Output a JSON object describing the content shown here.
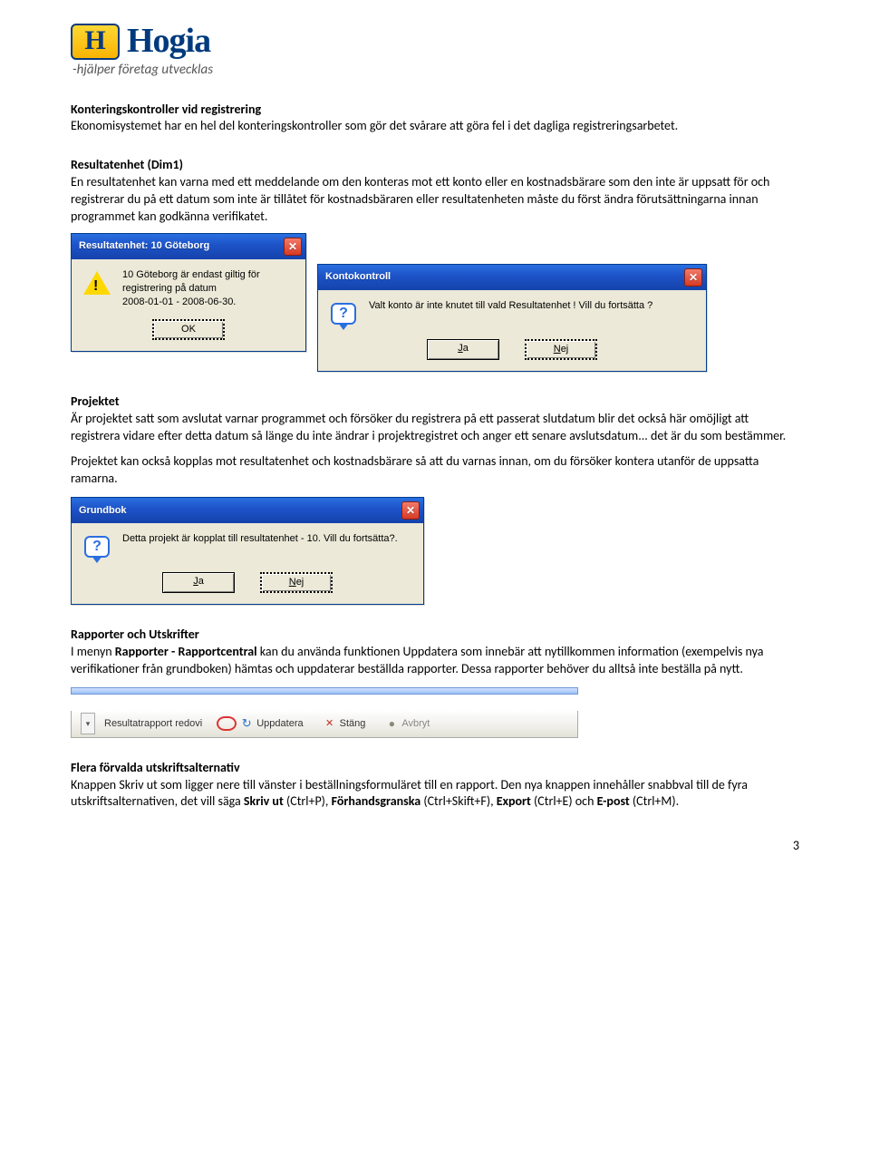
{
  "logo": {
    "mark": "H",
    "brand": "Hogia",
    "tagline": "-hjälper företag utvecklas"
  },
  "s1": {
    "h": "Konteringskontroller vid registrering",
    "p": "Ekonomisystemet har en hel del konteringskontroller som gör det svårare att göra fel i det dagliga registreringsarbetet."
  },
  "s2": {
    "h": "Resultatenhet (Dim1)",
    "p": "En resultatenhet kan varna med ett meddelande om den konteras mot ett konto eller en kostnadsbärare som den inte är uppsatt för och registrerar du på ett datum som inte är tillåtet för kostnadsbäraren eller resultatenheten måste du först ändra förutsättningarna innan programmet kan godkänna verifikatet."
  },
  "dlg1": {
    "title": "Resultatenhet: 10 Göteborg",
    "msg1": "10 Göteborg är endast giltig för",
    "msg2": "registrering på datum",
    "msg3": "2008-01-01 - 2008-06-30.",
    "ok": "OK"
  },
  "dlg2": {
    "title": "Kontokontroll",
    "msg": "Valt konto är inte knutet till vald Resultatenhet ! Vill du fortsätta ?",
    "yes": "Ja",
    "no": "Nej"
  },
  "s3": {
    "h": "Projektet",
    "p1": "Är projektet satt som avslutat varnar programmet och försöker du registrera på ett passerat slutdatum blir det också här omöjligt att registrera vidare efter detta datum så länge du inte ändrar i projektregistret och anger ett senare avslutsdatum... det är du som bestämmer.",
    "p2": "Projektet kan också kopplas mot resultatenhet och kostnadsbärare så att du varnas innan, om du försöker kontera utanför de uppsatta ramarna."
  },
  "dlg3": {
    "title": "Grundbok",
    "msg": "Detta projekt är kopplat till resultatenhet - 10. Vill du fortsätta?.",
    "yes": "Ja",
    "no": "Nej"
  },
  "s4": {
    "h": "Rapporter och Utskrifter",
    "p_pre": "I menyn ",
    "p_bold": "Rapporter - Rapportcentral",
    "p_post": " kan du använda funktionen Uppdatera som innebär att nytillkommen information (exempelvis nya verifikationer från grundboken) hämtas och uppdaterar beställda rapporter. Dessa rapporter behöver du alltså inte beställa på nytt."
  },
  "toolbar": {
    "rapport": "Resultatrapport redovi",
    "uppdatera": "Uppdatera",
    "stang": "Stäng",
    "avbryt": "Avbryt"
  },
  "s5": {
    "h": "Flera förvalda utskriftsalternativ",
    "p_pre": "Knappen Skriv ut som ligger nere till vänster i beställningsformuläret till en rapport. Den nya knappen innehåller snabbval till de fyra utskriftsalternativen, det vill säga ",
    "b1": "Skriv ut",
    "t1": " (Ctrl+P), ",
    "b2": "Förhandsgranska",
    "t2": " (Ctrl+Skift+F), ",
    "b3": "Export",
    "t3": " (Ctrl+E) och ",
    "b4": "E-post",
    "t4": " (Ctrl+M)."
  },
  "page_number": "3"
}
